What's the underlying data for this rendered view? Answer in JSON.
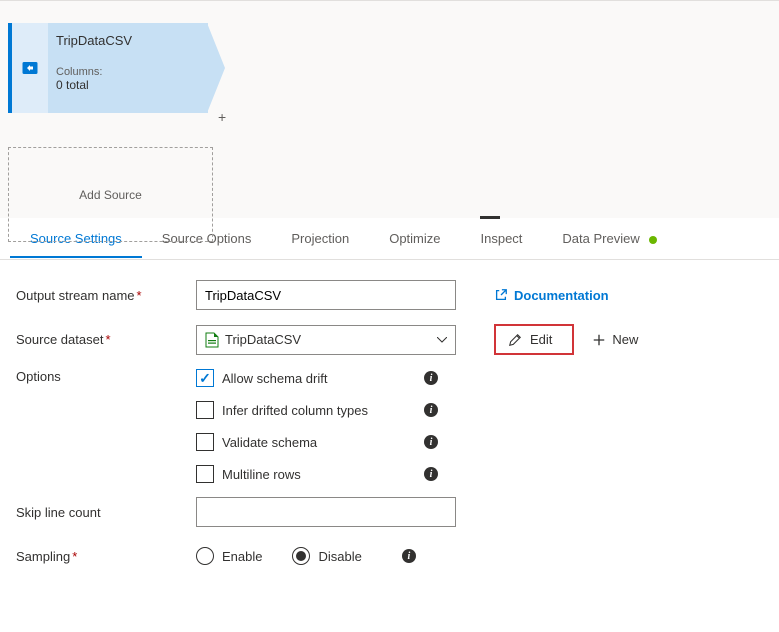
{
  "node": {
    "title": "TripDataCSV",
    "columns_label": "Columns:",
    "count": "0 total"
  },
  "add_source_label": "Add Source",
  "tabs": {
    "source_settings": "Source Settings",
    "source_options": "Source Options",
    "projection": "Projection",
    "optimize": "Optimize",
    "inspect": "Inspect",
    "data_preview": "Data Preview"
  },
  "form": {
    "output_stream_label": "Output stream name",
    "output_stream_value": "TripDataCSV",
    "source_dataset_label": "Source dataset",
    "source_dataset_value": "TripDataCSV",
    "options_label": "Options",
    "allow_schema_drift": "Allow schema drift",
    "infer_drifted": "Infer drifted column types",
    "validate_schema": "Validate schema",
    "multiline_rows": "Multiline rows",
    "skip_line_label": "Skip line count",
    "sampling_label": "Sampling",
    "enable": "Enable",
    "disable": "Disable"
  },
  "actions": {
    "documentation": "Documentation",
    "edit": "Edit",
    "new": "New"
  }
}
